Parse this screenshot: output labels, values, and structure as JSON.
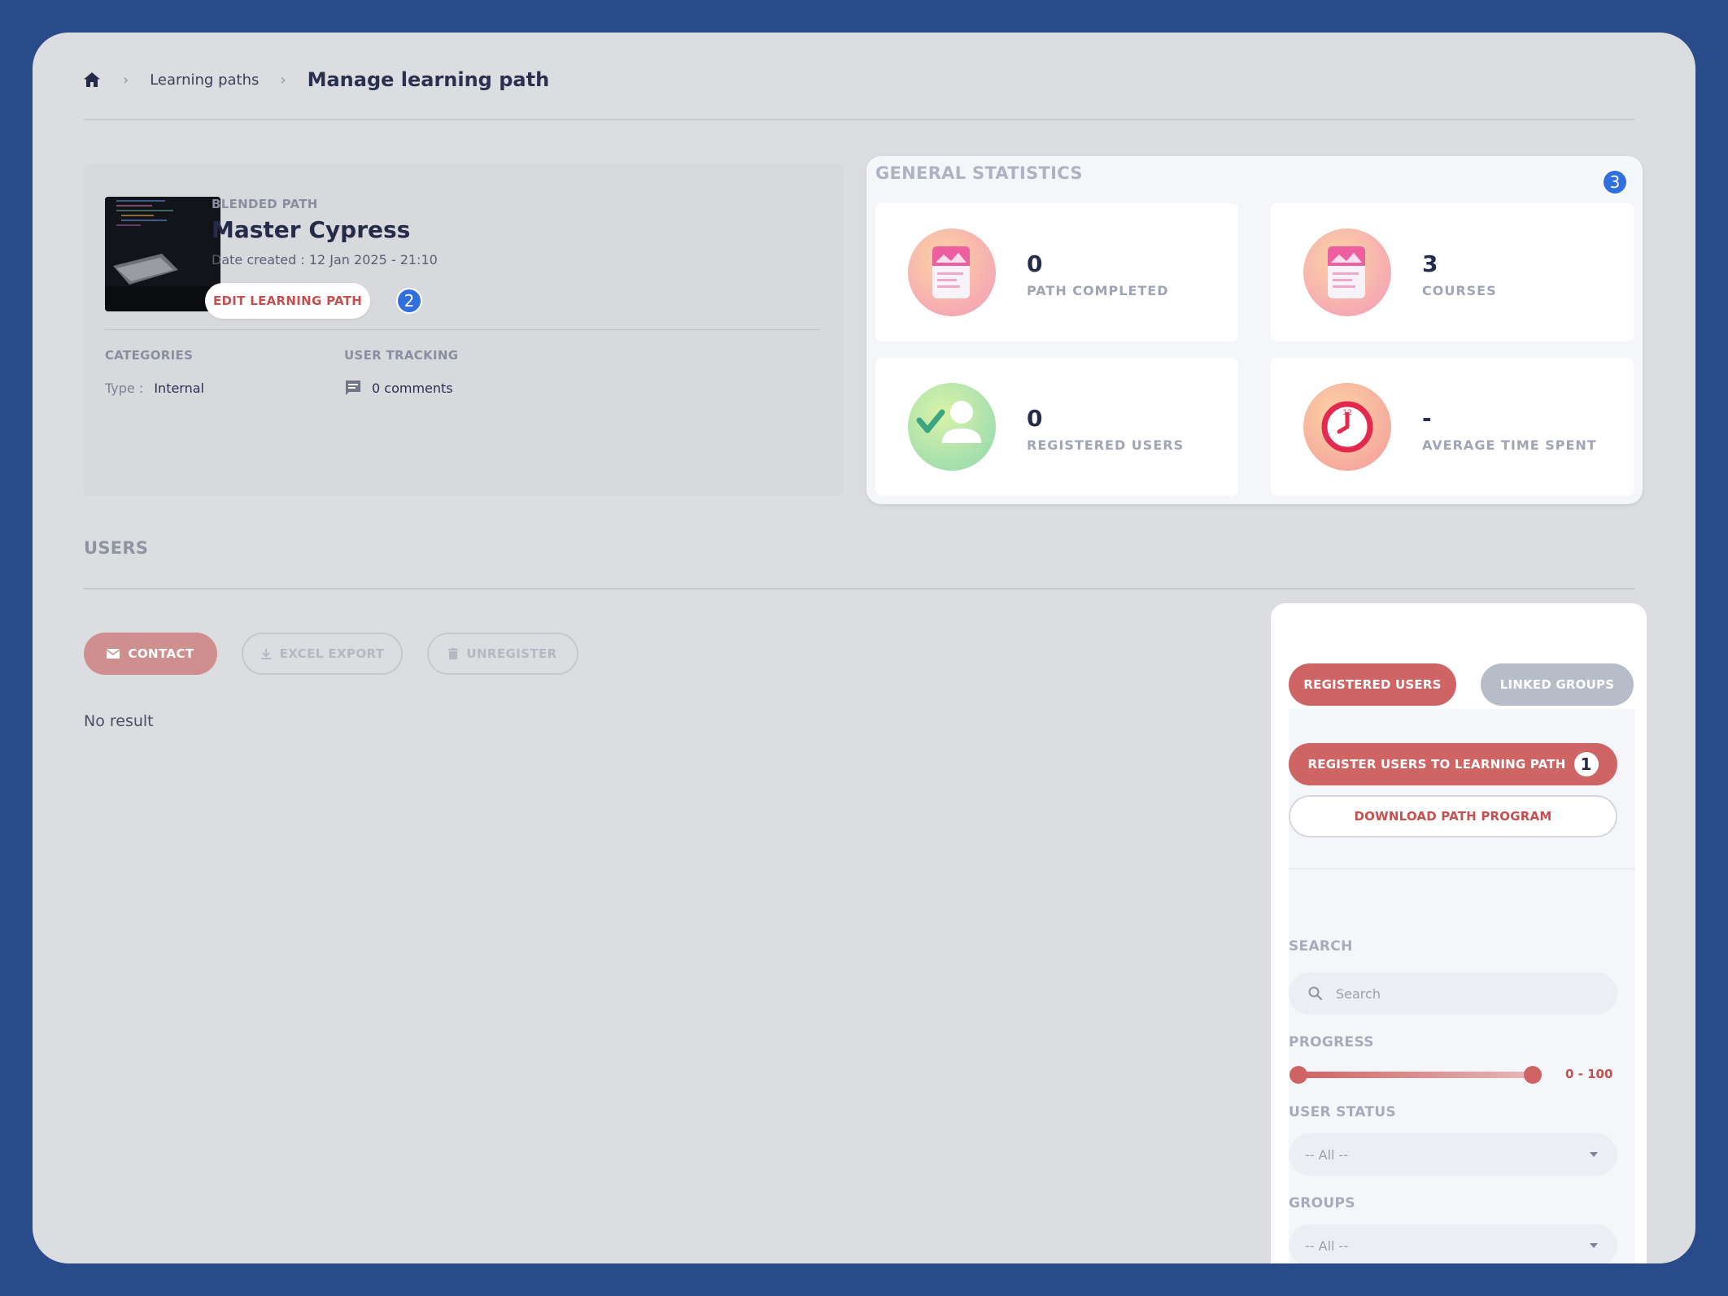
{
  "breadcrumb": {
    "home_icon": "home-icon",
    "items": [
      "Learning paths"
    ],
    "current": "Manage learning path"
  },
  "path": {
    "type_label": "BLENDED PATH",
    "title": "Master Cypress",
    "date_created": "Date created : 12 Jan 2025 - 21:10",
    "edit_label": "EDIT LEARNING PATH",
    "edit_badge": "2",
    "categories_label": "CATEGORIES",
    "type_key": "Type :",
    "type_value": "Internal",
    "tracking_label": "USER TRACKING",
    "comments": "0 comments"
  },
  "stats": {
    "title": "GENERAL STATISTICS",
    "badge": "3",
    "tiles": [
      {
        "value": "0",
        "label": "PATH COMPLETED",
        "icon": "document-icon"
      },
      {
        "value": "3",
        "label": "COURSES",
        "icon": "document-icon"
      },
      {
        "value": "0",
        "label": "REGISTERED USERS",
        "icon": "user-check-icon"
      },
      {
        "value": "-",
        "label": "AVERAGE TIME SPENT",
        "icon": "clock-icon"
      }
    ]
  },
  "users": {
    "title": "USERS",
    "contact": "CONTACT",
    "excel_export": "EXCEL EXPORT",
    "unregister": "UNREGISTER",
    "no_result": "No result"
  },
  "panel": {
    "tab_registered": "REGISTERED USERS",
    "tab_groups": "LINKED GROUPS",
    "register_btn": "REGISTER USERS TO LEARNING PATH",
    "register_badge": "1",
    "download_btn": "DOWNLOAD PATH PROGRAM",
    "search_label": "SEARCH",
    "search_placeholder": "Search",
    "progress_label": "PROGRESS",
    "progress_range": "0 - 100",
    "progress_min": 0,
    "progress_max": 100,
    "status_label": "USER STATUS",
    "status_value": "-- All --",
    "groups_label": "GROUPS",
    "groups_value": "-- All --"
  },
  "colors": {
    "accent": "#cf6464",
    "background": "#2a4b8a",
    "badge": "#2f6fe0"
  }
}
